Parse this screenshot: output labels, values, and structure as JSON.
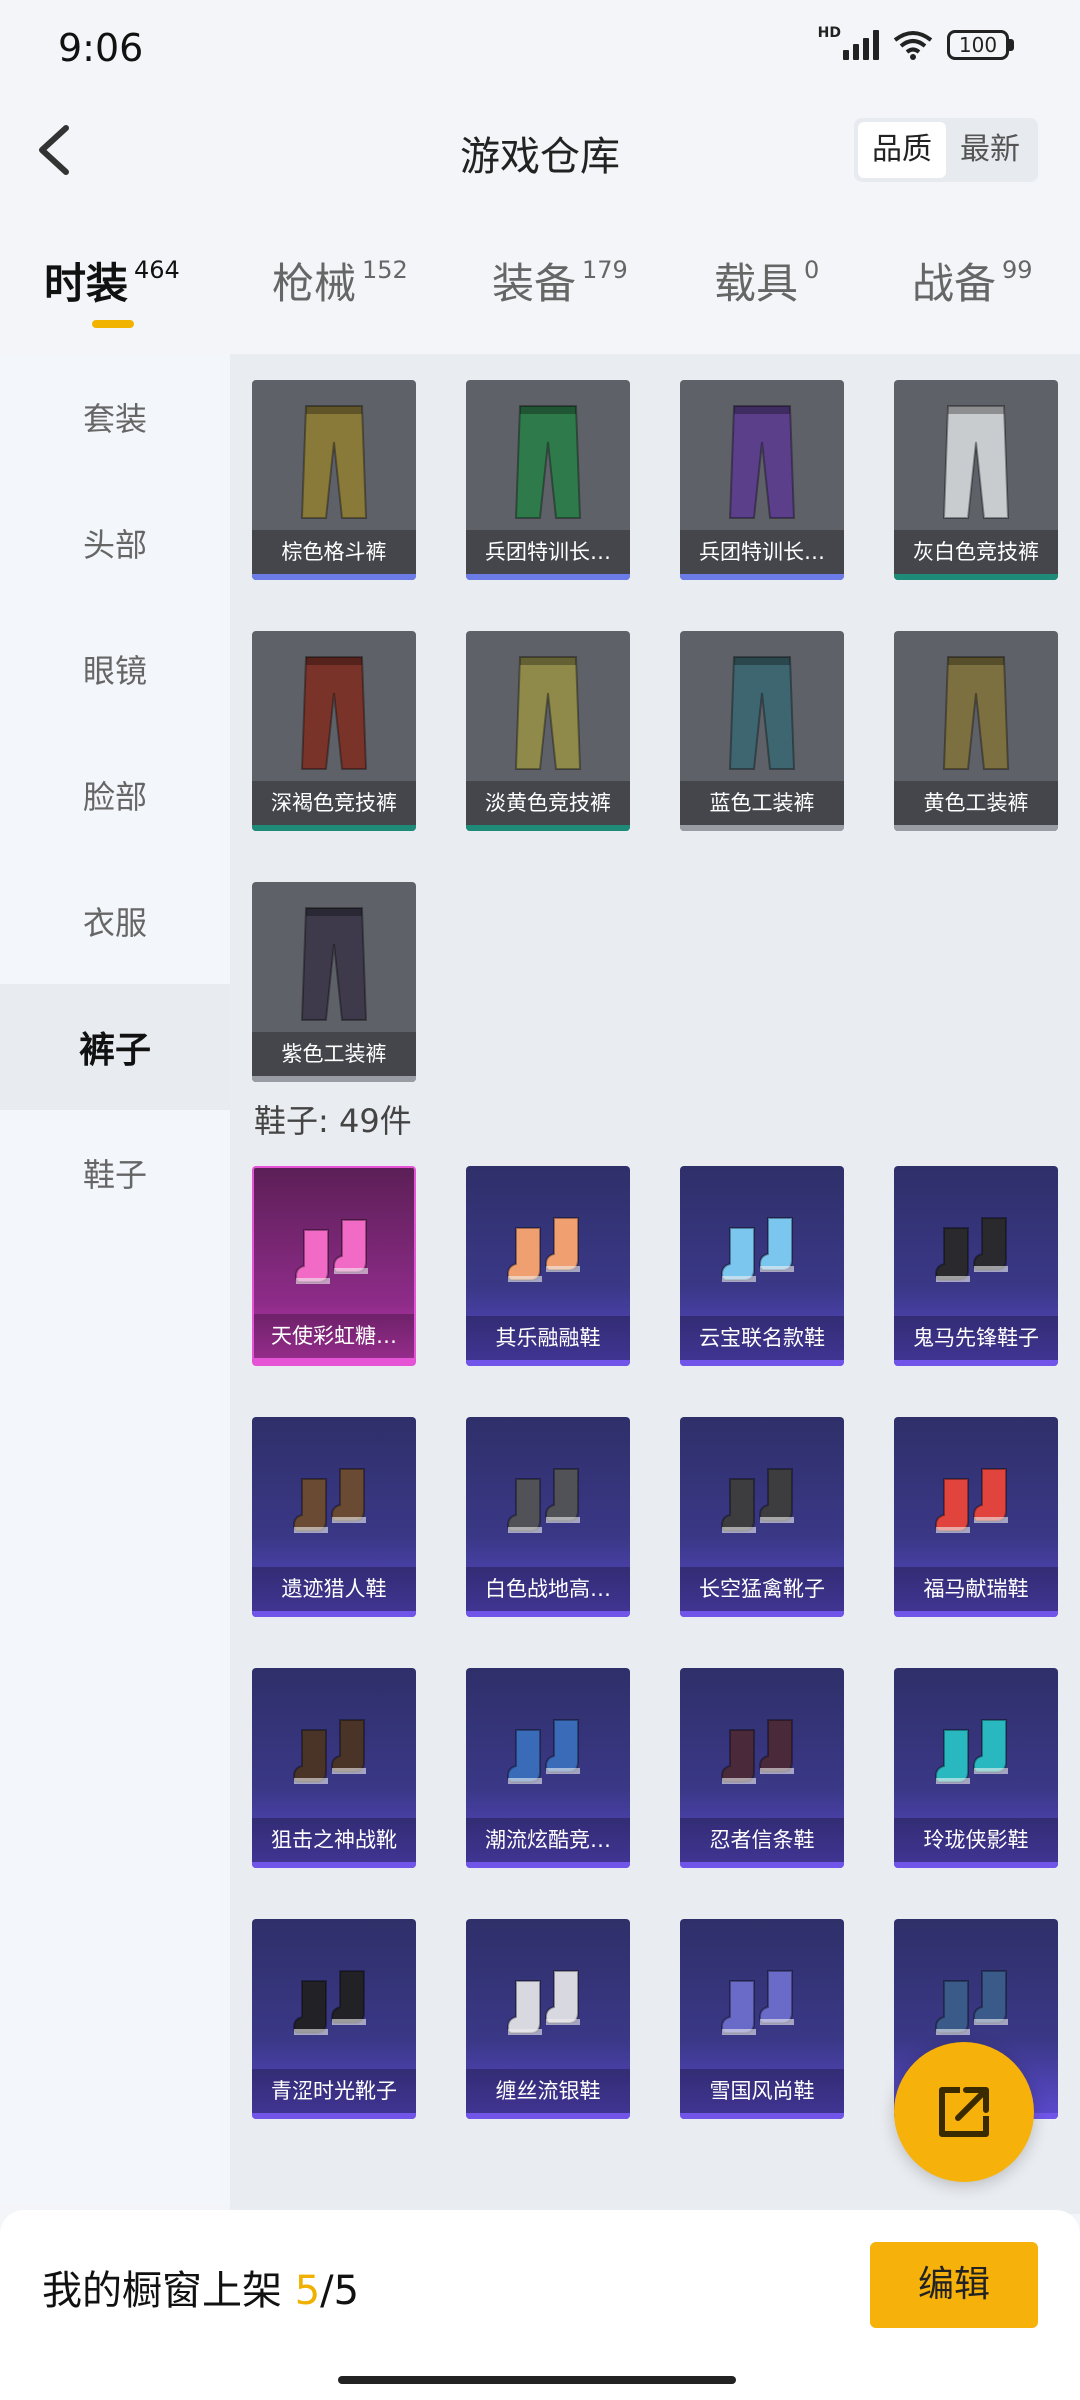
{
  "status": {
    "time": "9:06",
    "hd": "HD",
    "battery": "100"
  },
  "header": {
    "title": "游戏仓库",
    "sort": [
      "品质",
      "最新"
    ]
  },
  "tabs": [
    {
      "label": "时装",
      "count": "464"
    },
    {
      "label": "枪械",
      "count": "152"
    },
    {
      "label": "装备",
      "count": "179"
    },
    {
      "label": "载具",
      "count": "0"
    },
    {
      "label": "战备",
      "count": "99"
    }
  ],
  "sidebar": [
    "套装",
    "头部",
    "眼镜",
    "脸部",
    "衣服",
    "裤子",
    "鞋子"
  ],
  "pants": [
    {
      "name": "棕色格斗裤",
      "color": "#8a7a3a",
      "rarity": "blue"
    },
    {
      "name": "兵团特训长…",
      "color": "#2f7a4a",
      "rarity": "blue"
    },
    {
      "name": "兵团特训长…",
      "color": "#5b3f8a",
      "rarity": "blue"
    },
    {
      "name": "灰白色竞技裤",
      "color": "#c9cccf",
      "rarity": "teal"
    },
    {
      "name": "深褐色竞技裤",
      "color": "#7a3328",
      "rarity": "teal"
    },
    {
      "name": "淡黄色竞技裤",
      "color": "#8f8a4a",
      "rarity": "teal"
    },
    {
      "name": "蓝色工装裤",
      "color": "#3e6670",
      "rarity": "gray"
    },
    {
      "name": "黄色工装裤",
      "color": "#7d7040",
      "rarity": "gray"
    },
    {
      "name": "紫色工装裤",
      "color": "#3e3a4c",
      "rarity": "gray"
    }
  ],
  "shoes_section": "鞋子: 49件",
  "shoes": [
    {
      "name": "天使彩虹糖…",
      "color": "#f16ac6",
      "tier": "pink"
    },
    {
      "name": "其乐融融鞋",
      "color": "#f0a070",
      "tier": "purple"
    },
    {
      "name": "云宝联名款鞋",
      "color": "#7bc6ef",
      "tier": "purple"
    },
    {
      "name": "鬼马先锋鞋子",
      "color": "#2a2a2e",
      "tier": "purple"
    },
    {
      "name": "遗迹猎人鞋",
      "color": "#6a4a32",
      "tier": "purple"
    },
    {
      "name": "白色战地高…",
      "color": "#505258",
      "tier": "purple"
    },
    {
      "name": "长空猛禽靴子",
      "color": "#3d3d40",
      "tier": "purple"
    },
    {
      "name": "福马献瑞鞋",
      "color": "#e0443c",
      "tier": "purple"
    },
    {
      "name": "狙击之神战靴",
      "color": "#4a3428",
      "tier": "purple"
    },
    {
      "name": "潮流炫酷竞…",
      "color": "#3a6bb8",
      "tier": "purple"
    },
    {
      "name": "忍者信条鞋",
      "color": "#4a2a3a",
      "tier": "purple"
    },
    {
      "name": "玲珑侠影鞋",
      "color": "#2ab8c0",
      "tier": "purple"
    },
    {
      "name": "青涩时光靴子",
      "color": "#222226",
      "tier": "purple"
    },
    {
      "name": "缠丝流银鞋",
      "color": "#d8d8e0",
      "tier": "purple"
    },
    {
      "name": "雪国风尚鞋",
      "color": "#6a6ac8",
      "tier": "purple"
    },
    {
      "name": "",
      "color": "#3a5a8a",
      "tier": "purple"
    }
  ],
  "bottom": {
    "shelf_label": "我的橱窗上架 ",
    "shelf_count": "5",
    "shelf_total": "/5",
    "edit": "编辑"
  }
}
